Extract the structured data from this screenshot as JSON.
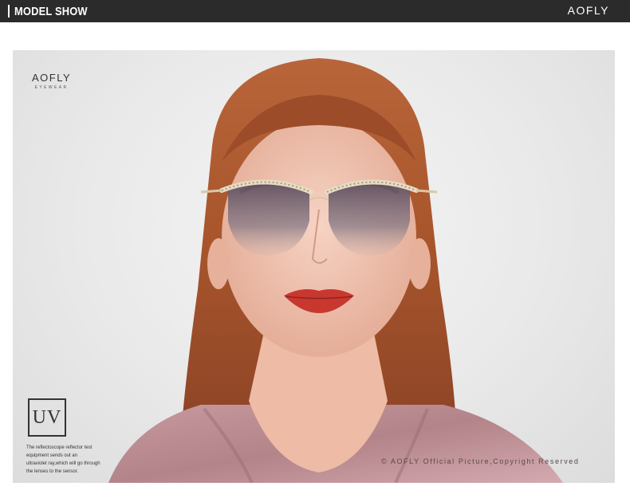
{
  "header": {
    "title": "MODEL SHOW",
    "brand": "AOFLY"
  },
  "logo": {
    "name": "AOFLY",
    "tagline": "EYEWEAR"
  },
  "uv_badge": {
    "label": "UV",
    "note_lines": [
      "The reflectoscope reflector test",
      "equipment sends out an",
      "ultraviolet ray,which will go through",
      "the lenses to the sensor."
    ]
  },
  "copyright": "© AOFLY Official Picture,Copyright Reserved",
  "colors": {
    "header_bg": "#2b2b2b",
    "hair": "#a8552c",
    "skin": "#f0c7b4",
    "lips": "#c8382f",
    "dress": "#b88a8f",
    "lens": "#7a6a78",
    "frame": "#d9c7a6"
  }
}
